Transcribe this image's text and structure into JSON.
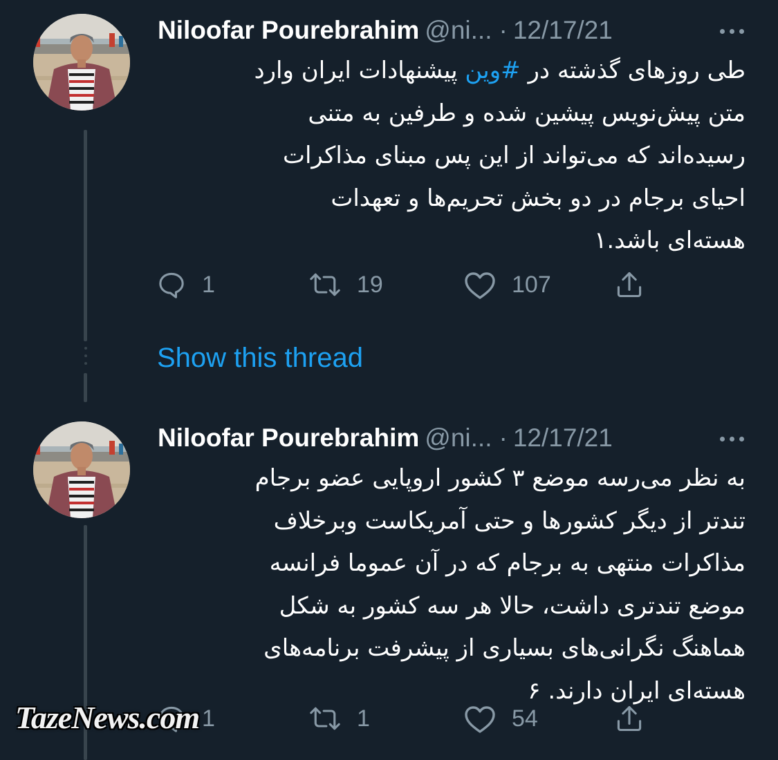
{
  "tweets": [
    {
      "author": {
        "name": "Niloofar Pourebrahim",
        "handle": "@ni...",
        "date": "12/17/21"
      },
      "text_before": "طی روزهای گذشته در ",
      "hashtag": "#وین",
      "text_after": " پیشنهادات ایران وارد\nمتن پیش‌نویس پیشین شده و طرفین به متنی\nرسیده‌اند که می‌تواند از این پس مبنای مذاکرات\nاحیای برجام در دو بخش تحریم‌ها و تعهدات\nهسته‌ای باشد.۱",
      "stats": {
        "replies": "1",
        "retweets": "19",
        "likes": "107"
      }
    },
    {
      "author": {
        "name": "Niloofar Pourebrahim",
        "handle": "@ni...",
        "date": "12/17/21"
      },
      "text": "به نظر می‌رسه موضع ۳ کشور اروپایی عضو برجام\nتندتر از دیگر کشورها و حتی آمریکاست وبرخلاف\nمذاکرات منتهی به برجام که در آن عموما فرانسه\nموضع تندتری داشت، حالا هر سه کشور به شکل\nهماهنگ نگرانی‌های بسیاری از پیشرفت برنامه‌های\nهسته‌ای ایران دارند. ۶",
      "stats": {
        "replies": "1",
        "retweets": "1",
        "likes": "54"
      }
    }
  ],
  "show_thread_label": "Show this thread",
  "watermark": "TazeNews.com",
  "icons": {
    "reply": "reply-icon",
    "retweet": "retweet-icon",
    "like": "heart-icon",
    "share": "share-icon",
    "more": "more-icon"
  },
  "colors": {
    "background": "#15202b",
    "secondary_text": "#8899a6",
    "accent": "#1da1f2",
    "thread_line": "#38444d"
  }
}
